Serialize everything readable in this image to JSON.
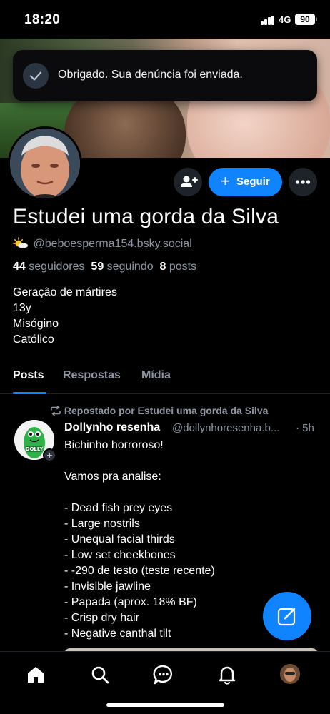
{
  "status_bar": {
    "time": "18:20",
    "network": "4G",
    "battery": "90"
  },
  "toast": {
    "message": "Obrigado. Sua denúncia foi enviada."
  },
  "profile": {
    "display_name": "Estudei uma gorda da Silva",
    "handle": "@beboesperma154.bsky.social",
    "handle_emoji": "🌥️",
    "stats": {
      "followers_count": "44",
      "followers_label": "seguidores",
      "following_count": "59",
      "following_label": "seguindo",
      "posts_count": "8",
      "posts_label": "posts"
    },
    "bio": [
      "Geração de mártires",
      "13y",
      "Misógino",
      "Católico"
    ]
  },
  "actions": {
    "follow_label": "Seguir"
  },
  "tabs": [
    {
      "label": "Posts",
      "active": true
    },
    {
      "label": "Respostas",
      "active": false
    },
    {
      "label": "Mídia",
      "active": false
    }
  ],
  "post": {
    "repost_label": "Repostado por Estudei uma gorda da Silva",
    "author": "Dollynho resenha",
    "handle": "@dollynhoresenha.b...",
    "separator": "·",
    "time": "5h",
    "lines": [
      "Bichinho horroroso!",
      "",
      "Vamos pra analise:",
      "",
      "- Dead fish prey eyes",
      "- Large nostrils",
      "- Unequal facial thirds",
      "- Low set cheekbones",
      "- -290 de testo (teste recente)",
      "- Invisible jawline",
      "- Papada (aprox. 18% BF)",
      "- Crisp dry hair",
      "- Negative canthal tilt"
    ],
    "avatar_text": "DOLLY"
  },
  "colors": {
    "accent": "#1083fe",
    "muted": "#8d97a4",
    "background": "#000000"
  },
  "icons": {
    "nav": [
      "home-icon",
      "search-icon",
      "chat-icon",
      "bell-icon",
      "profile-avatar"
    ],
    "fab": "compose-icon"
  }
}
